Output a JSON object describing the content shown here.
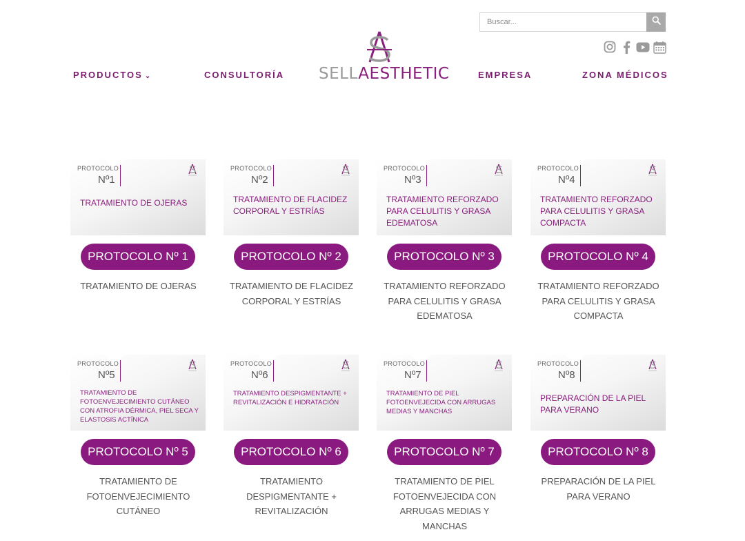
{
  "search": {
    "placeholder": "Buscar..."
  },
  "social": [
    "instagram-icon",
    "facebook-icon",
    "youtube-icon",
    "calendar-icon"
  ],
  "nav": {
    "productos": "PRODUCTOS",
    "consultoria": "CONSULTORÍA",
    "empresa": "EMPRESA",
    "zona_medicos": "ZONA MÉDICOS"
  },
  "logo": {
    "monogram_a": "A",
    "monogram_s": "S",
    "sell": "SELL",
    "aesthetic": "AESTHETIC"
  },
  "colors": {
    "brand": "#8a1a7f",
    "nav_text": "#7b1d6e",
    "grey": "#9a9a9a"
  },
  "cards": [
    {
      "tag": "PROTOCOLO",
      "num": "Nº1",
      "thumb_title": "TRATAMIENTO DE OJERAS",
      "button": "PROTOCOLO Nº 1",
      "desc": "TRATAMIENTO DE OJERAS"
    },
    {
      "tag": "PROTOCOLO",
      "num": "Nº2",
      "thumb_title": "TRATAMIENTO DE FLACIDEZ CORPORAL Y ESTRÍAS",
      "button": "PROTOCOLO Nº 2",
      "desc": "TRATAMIENTO DE FLACIDEZ CORPORAL Y ESTRÍAS"
    },
    {
      "tag": "PROTOCOLO",
      "num": "Nº3",
      "thumb_title": "TRATAMIENTO REFORZADO PARA CELULITIS Y GRASA EDEMATOSA",
      "button": "PROTOCOLO Nº 3",
      "desc": "TRATAMIENTO REFORZADO PARA CELULITIS Y GRASA EDEMATOSA"
    },
    {
      "tag": "PROTOCOLO",
      "num": "Nº4",
      "thumb_title": "TRATAMIENTO REFORZADO PARA CELULITIS Y GRASA COMPACTA",
      "button": "PROTOCOLO Nº 4",
      "desc": "TRATAMIENTO REFORZADO PARA CELULITIS Y GRASA COMPACTA"
    },
    {
      "tag": "PROTOCOLO",
      "num": "Nº5",
      "thumb_title": "TRATAMIENTO DE FOTOENVEJECIMIENTO CUTÁNEO CON ATROFIA DÉRMICA, PIEL SECA Y ELASTOSIS ACTÍNICA",
      "button": "PROTOCOLO Nº 5",
      "desc": "TRATAMIENTO DE FOTOENVEJECIMIENTO CUTÁNEO"
    },
    {
      "tag": "PROTOCOLO",
      "num": "Nº6",
      "thumb_title": "TRATAMIENTO DESPIGMENTANTE + REVITALIZACIÓN E HIDRATACIÓN",
      "button": "PROTOCOLO Nº 6",
      "desc": "TRATAMIENTO DESPIGMENTANTE + REVITALIZACIÓN"
    },
    {
      "tag": "PROTOCOLO",
      "num": "Nº7",
      "thumb_title": "TRATAMIENTO DE PIEL FOTOENVEJECIDA CON ARRUGAS MEDIAS Y MANCHAS",
      "button": "PROTOCOLO Nº 7",
      "desc": "TRATAMIENTO DE PIEL FOTOENVEJECIDA CON ARRUGAS MEDIAS Y MANCHAS"
    },
    {
      "tag": "PROTOCOLO",
      "num": "Nº8",
      "thumb_title": "PREPARACIÓN DE LA PIEL PARA VERANO",
      "button": "PROTOCOLO Nº 8",
      "desc": "PREPARACIÓN DE LA PIEL PARA VERANO"
    }
  ]
}
